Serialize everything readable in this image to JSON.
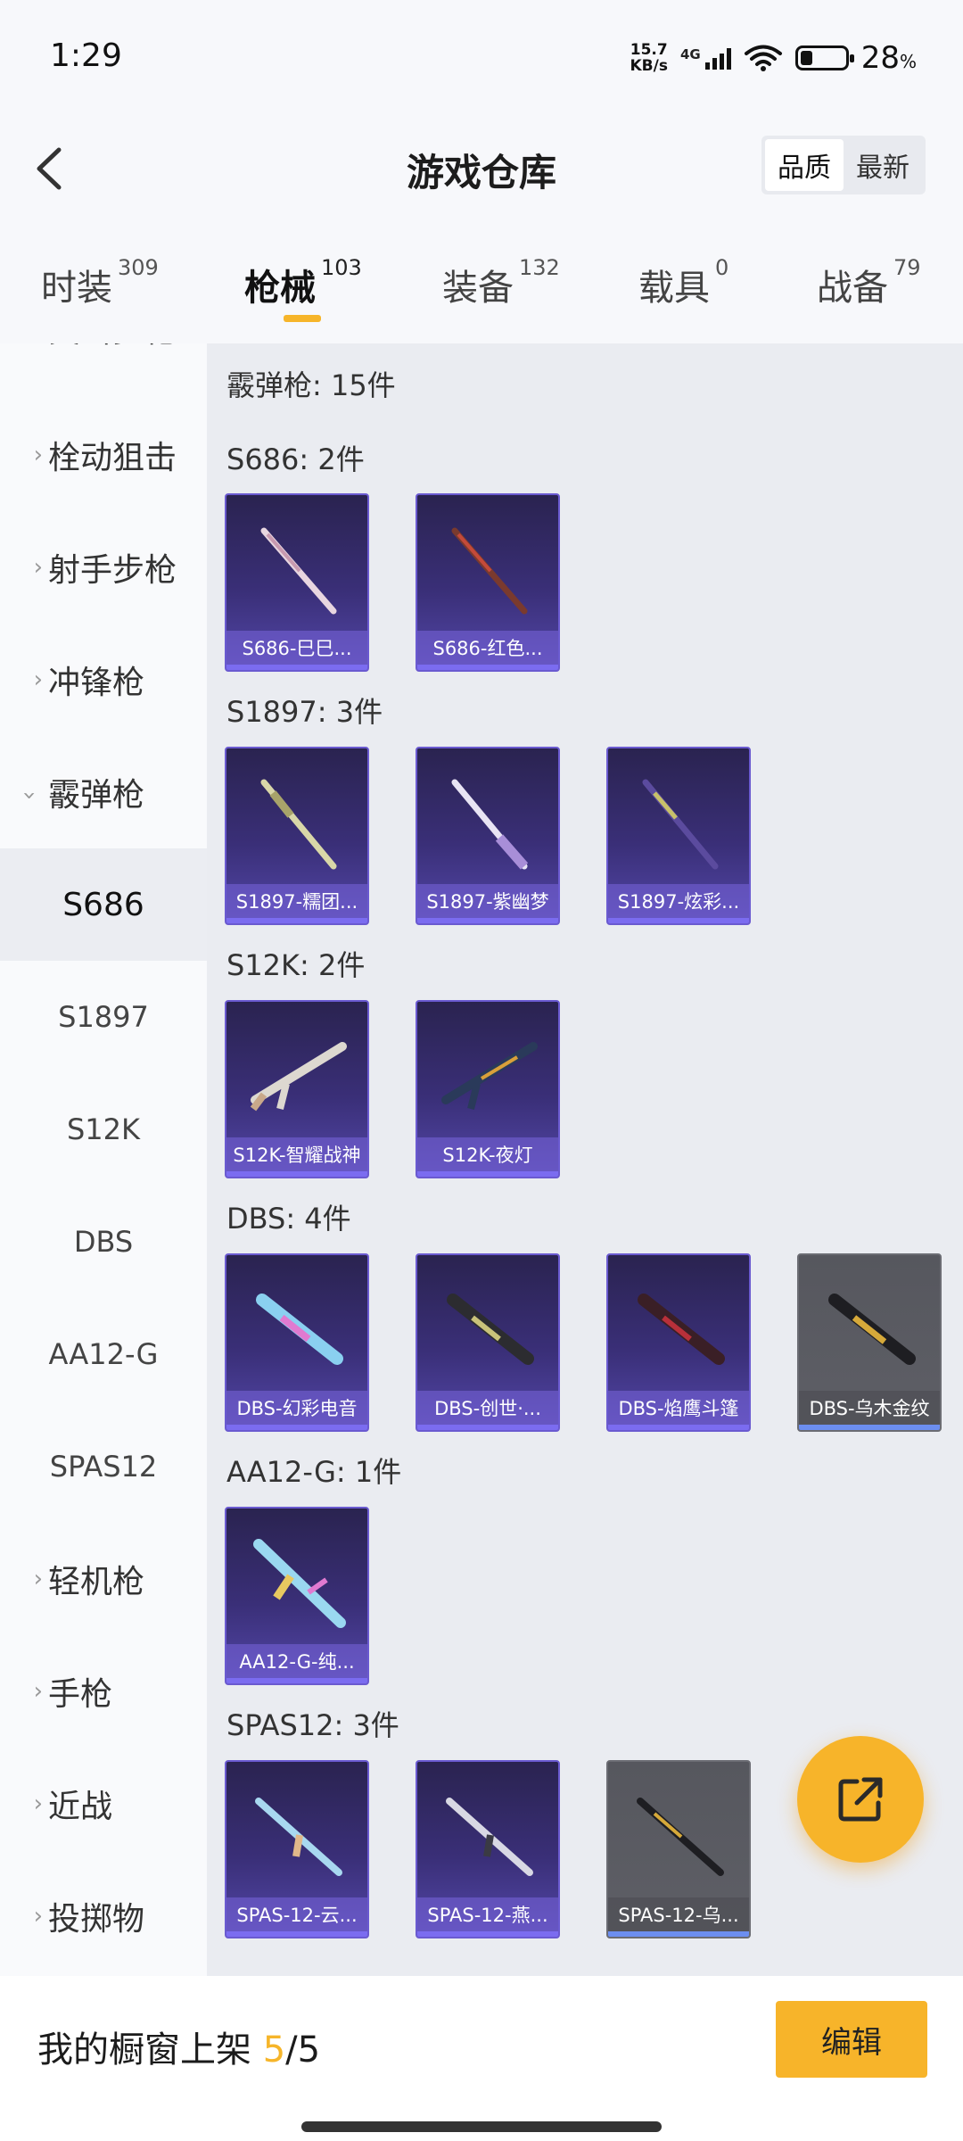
{
  "status_bar": {
    "time": "1:29",
    "net_speed_value": "15.7",
    "net_speed_unit": "KB/s",
    "network": "4G",
    "battery_percent": "28",
    "battery_unit": "%"
  },
  "header": {
    "title": "游戏仓库",
    "sort_options": [
      "品质",
      "最新"
    ],
    "active_sort": "品质"
  },
  "tabs": [
    {
      "label": "时装",
      "count": "309"
    },
    {
      "label": "枪械",
      "count": "103"
    },
    {
      "label": "装备",
      "count": "132"
    },
    {
      "label": "载具",
      "count": "0"
    },
    {
      "label": "战备",
      "count": "79"
    }
  ],
  "active_tab": "枪械",
  "sidebar": {
    "items": [
      {
        "label": "突击步枪"
      },
      {
        "label": "栓动狙击"
      },
      {
        "label": "射手步枪"
      },
      {
        "label": "冲锋枪"
      },
      {
        "label": "霰弹枪"
      },
      {
        "label": "S686"
      },
      {
        "label": "S1897"
      },
      {
        "label": "S12K"
      },
      {
        "label": "DBS"
      },
      {
        "label": "AA12-G"
      },
      {
        "label": "SPAS12"
      },
      {
        "label": "轻机枪"
      },
      {
        "label": "手枪"
      },
      {
        "label": "近战"
      },
      {
        "label": "投掷物"
      }
    ],
    "selected": "S686"
  },
  "content": {
    "category_summary": "霰弹枪: 15件",
    "groups": [
      {
        "title": "S686: 2件",
        "items": [
          "S686-巳巳...",
          "S686-红色..."
        ]
      },
      {
        "title": "S1897: 3件",
        "items": [
          "S1897-糯团...",
          "S1897-紫幽梦",
          "S1897-炫彩..."
        ]
      },
      {
        "title": "S12K: 2件",
        "items": [
          "S12K-智耀战神",
          "S12K-夜灯"
        ]
      },
      {
        "title": "DBS: 4件",
        "items": [
          "DBS-幻彩电音",
          "DBS-创世·...",
          "DBS-焰鹰斗篷",
          "DBS-乌木金纹"
        ]
      },
      {
        "title": "AA12-G: 1件",
        "items": [
          "AA12-G-纯..."
        ]
      },
      {
        "title": "SPAS12: 3件",
        "items": [
          "SPAS-12-云...",
          "SPAS-12-燕...",
          "SPAS-12-乌..."
        ]
      }
    ]
  },
  "bottom_bar": {
    "label": "我的橱窗上架",
    "count_current": "5",
    "count_sep": "/",
    "count_total": "5",
    "edit_label": "编辑"
  },
  "colors": {
    "accent": "#f7b42a",
    "card_purple": "#3a2f78",
    "card_gray": "#5e5f66"
  }
}
